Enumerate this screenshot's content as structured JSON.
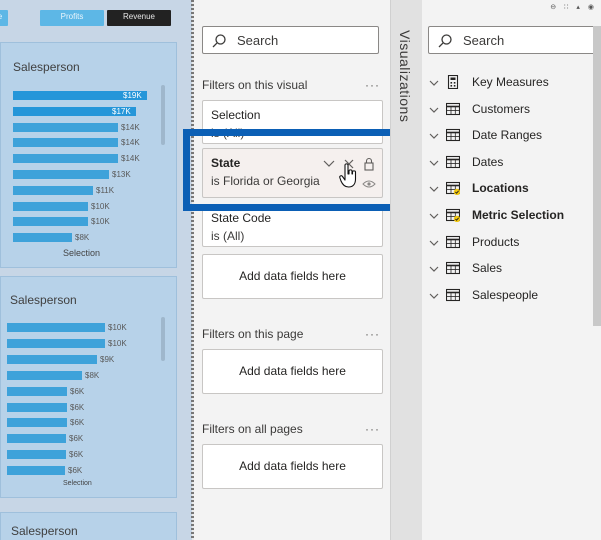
{
  "canvas": {
    "top_buttons": {
      "edge": "e",
      "profits": "Profits",
      "revenue": "Revenue"
    },
    "card1": {
      "title": "Salesperson",
      "rows": [
        {
          "label": "—",
          "value": "$19K",
          "fraction": 1.0,
          "selected": true
        },
        {
          "label": "y",
          "value": "$17K",
          "fraction": 0.92,
          "selected": true
        },
        {
          "label": "z",
          "value": "$14K",
          "fraction": 0.78,
          "selected": false
        },
        {
          "label": "s",
          "value": "$14K",
          "fraction": 0.78,
          "selected": false
        },
        {
          "label": "—",
          "value": "$14K",
          "fraction": 0.78,
          "selected": false
        },
        {
          "label": "—",
          "value": "$13K",
          "fraction": 0.72,
          "selected": false
        },
        {
          "label": "—",
          "value": "$11K",
          "fraction": 0.6,
          "selected": false
        },
        {
          "label": "—",
          "value": "$10K",
          "fraction": 0.56,
          "selected": false
        },
        {
          "label": "r",
          "value": "$10K",
          "fraction": 0.56,
          "selected": false
        },
        {
          "label": "r",
          "value": "$8K",
          "fraction": 0.44,
          "selected": false
        }
      ],
      "caption": "Selection"
    },
    "card2": {
      "title": "Salesperson",
      "rows": [
        {
          "value": "$10K",
          "fraction": 1.0
        },
        {
          "value": "$10K",
          "fraction": 1.0
        },
        {
          "value": "$9K",
          "fraction": 0.92
        },
        {
          "value": "$8K",
          "fraction": 0.77
        },
        {
          "value": "$6K",
          "fraction": 0.61
        },
        {
          "value": "$6K",
          "fraction": 0.61
        },
        {
          "value": "$6K",
          "fraction": 0.61
        },
        {
          "value": "$6K",
          "fraction": 0.6
        },
        {
          "value": "$6K",
          "fraction": 0.6
        },
        {
          "value": "$6K",
          "fraction": 0.59
        }
      ],
      "caption": "Selection"
    },
    "card3": {
      "title": "Salesperson"
    }
  },
  "filters": {
    "search_placeholder": "Search",
    "visual_section": "Filters on this visual",
    "more": "···",
    "cards": {
      "selection": {
        "name": "Selection",
        "value": "is (All)"
      },
      "state": {
        "name": "State",
        "value": "is Florida or Georgia"
      },
      "state_code": {
        "name": "State Code",
        "value": "is (All)"
      }
    },
    "add_fields": "Add data fields here",
    "page_section": "Filters on this page",
    "all_pages_section": "Filters on all pages"
  },
  "visualizations": {
    "label": "Visualizations"
  },
  "fields": {
    "search_placeholder": "Search",
    "items": [
      {
        "name": "Key Measures",
        "icon": "calculator-icon",
        "bold": false
      },
      {
        "name": "Customers",
        "icon": "table-icon",
        "bold": false
      },
      {
        "name": "Date Ranges",
        "icon": "table-icon",
        "bold": false
      },
      {
        "name": "Dates",
        "icon": "table-icon",
        "bold": false
      },
      {
        "name": "Locations",
        "icon": "table-checked-icon",
        "bold": true
      },
      {
        "name": "Metric Selection",
        "icon": "table-checked-icon",
        "bold": true
      },
      {
        "name": "Products",
        "icon": "table-icon",
        "bold": false
      },
      {
        "name": "Sales",
        "icon": "table-icon",
        "bold": false
      },
      {
        "name": "Salespeople",
        "icon": "table-icon",
        "bold": false
      }
    ]
  },
  "colors": {
    "accent_highlight": "#0b5fb5",
    "bar": "#3ea2da",
    "check_badge": "#f2c811"
  }
}
